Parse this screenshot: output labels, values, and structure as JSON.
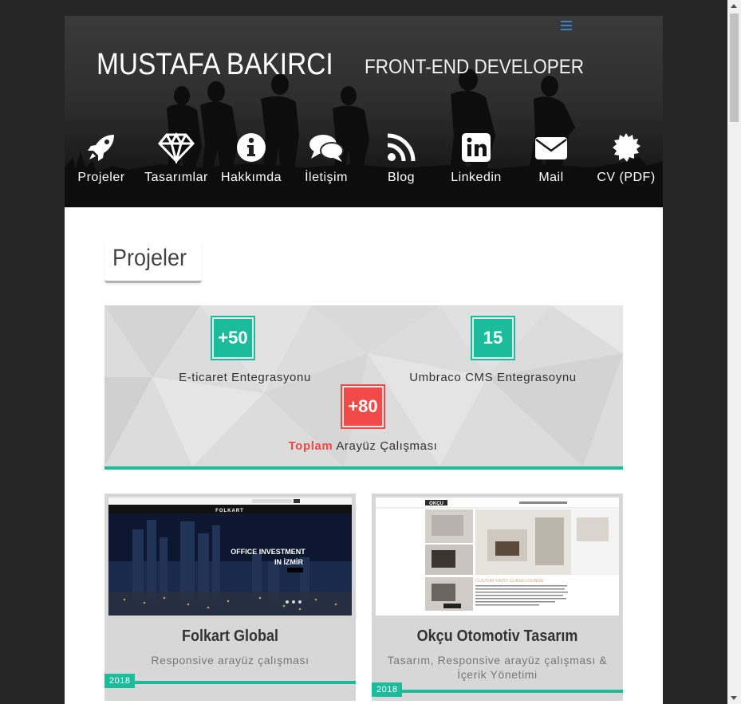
{
  "header": {
    "brand": "MUSTAFA BAKIRCI",
    "tagline": "FRONT-END DEVELOPER",
    "nav": [
      {
        "label": "Projeler",
        "icon": "rocket-icon"
      },
      {
        "label": "Tasarımlar",
        "icon": "diamond-icon"
      },
      {
        "label": "Hakkımda",
        "icon": "info-icon"
      },
      {
        "label": "İletişim",
        "icon": "comments-icon"
      },
      {
        "label": "Blog",
        "icon": "rss-icon"
      },
      {
        "label": "Linkedin",
        "icon": "linkedin-icon"
      },
      {
        "label": "Mail",
        "icon": "envelope-icon"
      },
      {
        "label": "CV (PDF)",
        "icon": "certificate-icon"
      }
    ]
  },
  "main": {
    "section_title": "Projeler",
    "stats": [
      {
        "value": "+50",
        "label": "E-ticaret Entegrasyonu",
        "color": "#1abc9c"
      },
      {
        "value": "15",
        "label": "Umbraco CMS Entegrasoynu",
        "color": "#1abc9c"
      },
      {
        "value": "+80",
        "label_accent": "Toplam",
        "label_rest": "Arayüz Çalışması",
        "color": "#f24a48"
      }
    ],
    "projects": [
      {
        "title": "Folkart Global",
        "description": "Responsive arayüz çalışması",
        "year": "2018",
        "thumb": {
          "logo": "FOLKART",
          "headline_1": "OFFICE INVESTMENT",
          "headline_2": "IN İZMİR"
        }
      },
      {
        "title": "Okçu Otomotiv Tasarım",
        "description": "Tasarım, Responsive arayüz çalışması & İçerik Yönetimi",
        "year": "2018",
        "thumb": {
          "logo": "OKÇU",
          "caption": "CUSTOM FIRST CLASS LOUNGE"
        }
      }
    ]
  },
  "colors": {
    "accent": "#1abc9c",
    "red": "#f24a48",
    "menu_toggle": "#3b83c4"
  }
}
